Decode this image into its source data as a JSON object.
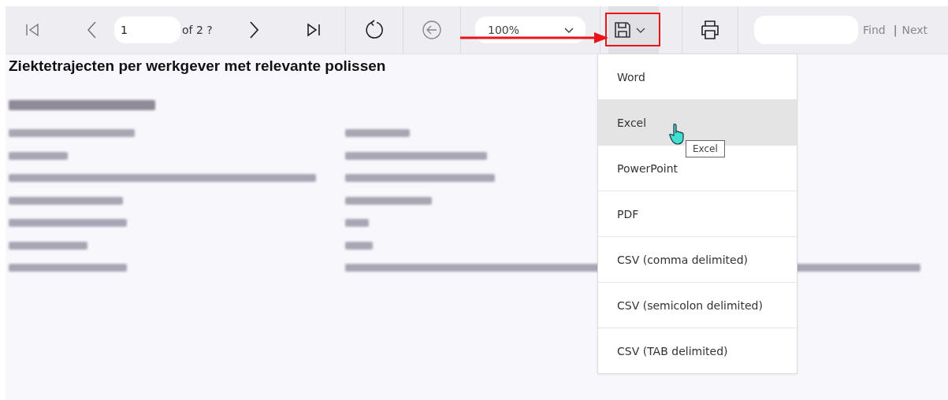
{
  "toolbar": {
    "page_field": {
      "value": "1"
    },
    "page_count": "of 2 ?",
    "zoom_field": {
      "value": "100%"
    },
    "export": {
      "highlighted": true,
      "open": true
    },
    "find_label": "Find",
    "separator": "|",
    "next_label": "Next"
  },
  "report": {
    "title": "Ziektetrajecten per werkgever met relevante polissen"
  },
  "export_menu": {
    "items": [
      {
        "label": "Word",
        "selected": false
      },
      {
        "label": "Excel",
        "selected": true
      },
      {
        "label": "PowerPoint",
        "selected": false
      },
      {
        "label": "PDF",
        "selected": false
      },
      {
        "label": "CSV (comma delimited)",
        "selected": false
      },
      {
        "label": "CSV (semicolon delimited)",
        "selected": false
      },
      {
        "label": "CSV (TAB delimited)",
        "selected": false
      }
    ]
  },
  "tooltip": "Excel"
}
